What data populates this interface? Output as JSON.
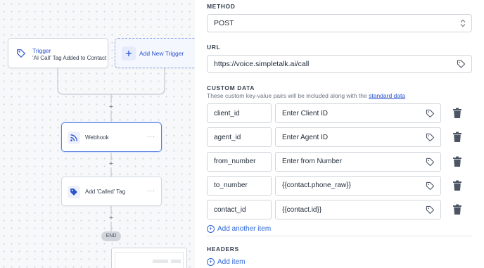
{
  "canvas": {
    "trigger": {
      "title": "Trigger",
      "subtitle": "'AI Call' Tag Added to Contact",
      "icon": "tag-outline-icon"
    },
    "add_trigger": {
      "label": "Add New Trigger",
      "icon": "plus-icon"
    },
    "webhook": {
      "label": "Webhook",
      "menu": "···",
      "icon": "rss-icon"
    },
    "tag_action": {
      "label": "Add 'Called' Tag",
      "menu": "···",
      "icon": "tag-filled-icon"
    },
    "end_label": "END",
    "plus_symbol": "+"
  },
  "form": {
    "method": {
      "title": "METHOD",
      "value": "POST"
    },
    "url": {
      "title": "URL",
      "value": "https://voice.simpletalk.ai/call"
    },
    "custom_data": {
      "title": "CUSTOM DATA",
      "description": "These custom key-value pairs will be included along with the",
      "link_text": "standard data",
      "rows": [
        {
          "key": "client_id",
          "value": "Enter Client ID"
        },
        {
          "key": "agent_id",
          "value": "Enter Agent ID"
        },
        {
          "key": "from_number",
          "value": "Enter from Number"
        },
        {
          "key": "to_number",
          "value": "{{contact.phone_raw}}"
        },
        {
          "key": "contact_id",
          "value": "{{contact.id}}"
        }
      ],
      "add_label": "Add another item"
    },
    "headers": {
      "title": "HEADERS",
      "add_label": "Add item"
    }
  },
  "colors": {
    "accent": "#2952cc",
    "link": "#2f66d6",
    "border": "#d1d5db",
    "trash": "#4b5563"
  }
}
